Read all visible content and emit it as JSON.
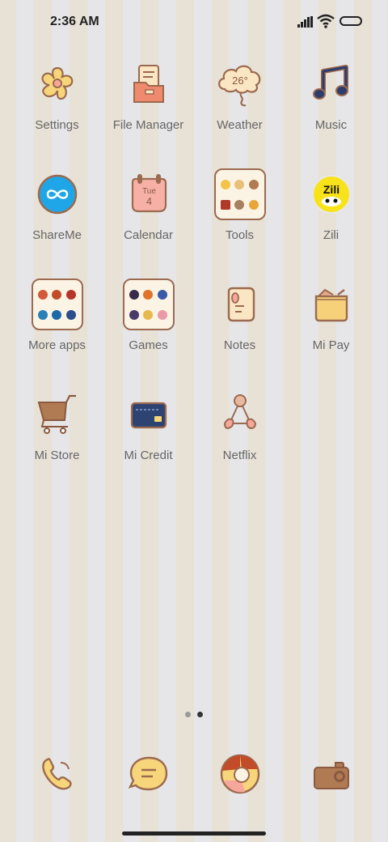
{
  "status_bar": {
    "time": "2:36 AM"
  },
  "apps": [
    {
      "label": "Settings",
      "icon": "flower-icon"
    },
    {
      "label": "File Manager",
      "icon": "file-manager-icon"
    },
    {
      "label": "Weather",
      "icon": "weather-cloud-icon",
      "icon_text": "26°"
    },
    {
      "label": "Music",
      "icon": "music-note-icon"
    },
    {
      "label": "ShareMe",
      "icon": "shareme-icon"
    },
    {
      "label": "Calendar",
      "icon": "calendar-icon",
      "icon_day": "Tue",
      "icon_date": "4"
    },
    {
      "label": "Tools",
      "icon": "tools-folder-icon"
    },
    {
      "label": "Zili",
      "icon": "zili-icon",
      "icon_text": "Zili"
    },
    {
      "label": "More apps",
      "icon": "more-apps-folder-icon"
    },
    {
      "label": "Games",
      "icon": "games-folder-icon"
    },
    {
      "label": "Notes",
      "icon": "notes-icon"
    },
    {
      "label": "Mi Pay",
      "icon": "wallet-icon"
    },
    {
      "label": "Mi Store",
      "icon": "shopping-cart-icon"
    },
    {
      "label": "Mi Credit",
      "icon": "credit-card-icon"
    },
    {
      "label": "Netflix",
      "icon": "netflix-icon"
    }
  ],
  "page_indicator": {
    "count": 2,
    "active": 2
  },
  "dock": [
    {
      "icon": "phone-icon"
    },
    {
      "icon": "message-icon"
    },
    {
      "icon": "browser-icon"
    },
    {
      "icon": "camera-icon"
    }
  ],
  "colors": {
    "stripe_beige": "#e7e1d6",
    "stripe_grey": "#e6e6e8",
    "outline_brown": "#9b6a4f",
    "icon_yellow": "#f7d57a",
    "icon_pink": "#f6a69a",
    "label_grey": "#666666"
  }
}
